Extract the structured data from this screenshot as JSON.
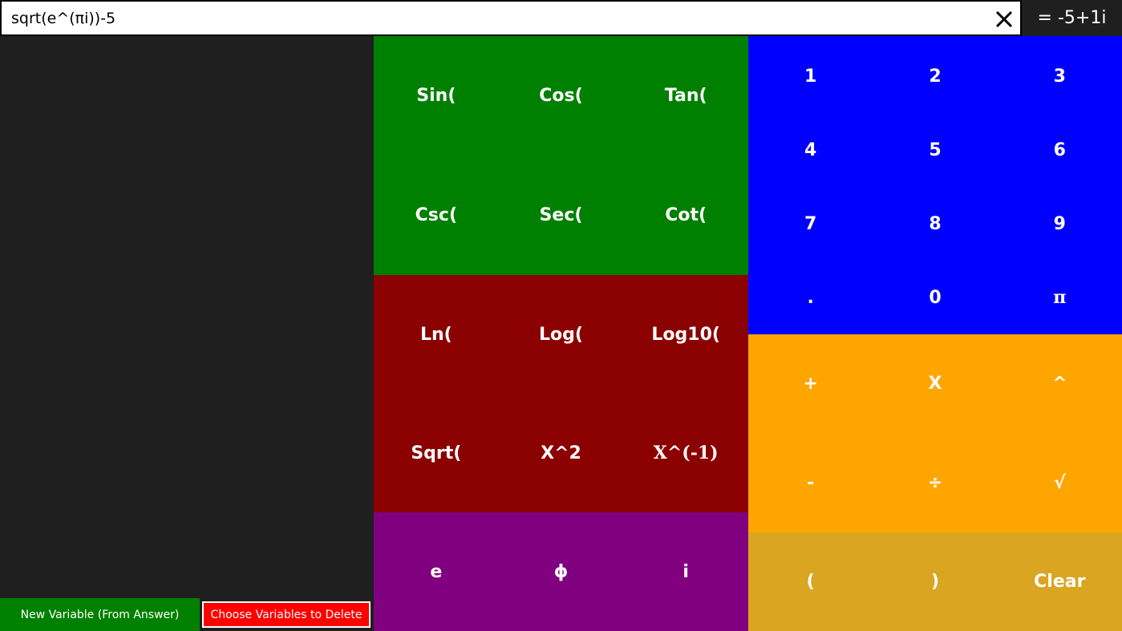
{
  "expression": {
    "value": "sqrt(e^(πi))-5",
    "clear_icon": "close-icon"
  },
  "result": {
    "text": "= -5+1i"
  },
  "variables": {
    "items": [],
    "new_variable_label": "New Variable (From Answer)",
    "delete_variables_label": "Choose Variables to Delete"
  },
  "keypad": {
    "trig": [
      "Sin(",
      "Cos(",
      "Tan(",
      "Csc(",
      "Sec(",
      "Cot("
    ],
    "logs": [
      "Ln(",
      "Log(",
      "Log10(",
      "Sqrt(",
      "X^2",
      "X^(-1)"
    ],
    "constants": [
      "e",
      "ϕ",
      "i"
    ],
    "digits": [
      "1",
      "2",
      "3",
      "4",
      "5",
      "6",
      "7",
      "8",
      "9",
      ".",
      "0",
      "π"
    ],
    "operators": [
      "+",
      "X",
      "^",
      "-",
      "÷",
      "√"
    ],
    "bottom": [
      "(",
      ")",
      "Clear"
    ]
  },
  "colors": {
    "trig": "#008000",
    "logs": "#8b0000",
    "constants": "#800080",
    "digits": "#0000ff",
    "operators": "#ffa500",
    "bottom": "#daa520",
    "variables_panel": "#1f1f1f",
    "new_variable_button": "#008000",
    "delete_variables_button": "#ff0000"
  }
}
